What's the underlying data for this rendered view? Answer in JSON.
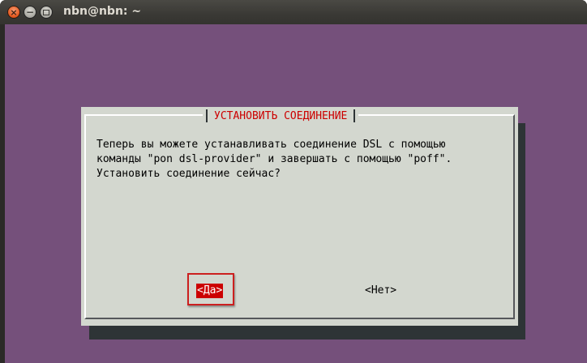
{
  "window": {
    "title": "nbn@nbn: ~",
    "close_glyph": "×",
    "minimize_glyph": "−",
    "icons": [
      "close-icon",
      "minimize-icon",
      "maximize-icon"
    ]
  },
  "dialog": {
    "title": "УСТАНОВИТЬ СОЕДИНЕНИЕ",
    "message": "Теперь вы можете устанавливать соединение DSL с помощью\nкоманды \"pon dsl-provider\" и завершать с помощью \"poff\".\nУстановить соединение сейчас?",
    "yes_label": "<Да>",
    "no_label": "<Нет>"
  },
  "colors": {
    "terminal_bg": "#75507b",
    "dialog_bg": "#d3d7cf",
    "title_text": "#cc0000",
    "selected_button_bg": "#cc0000",
    "highlight_box": "#cc1f1f"
  }
}
